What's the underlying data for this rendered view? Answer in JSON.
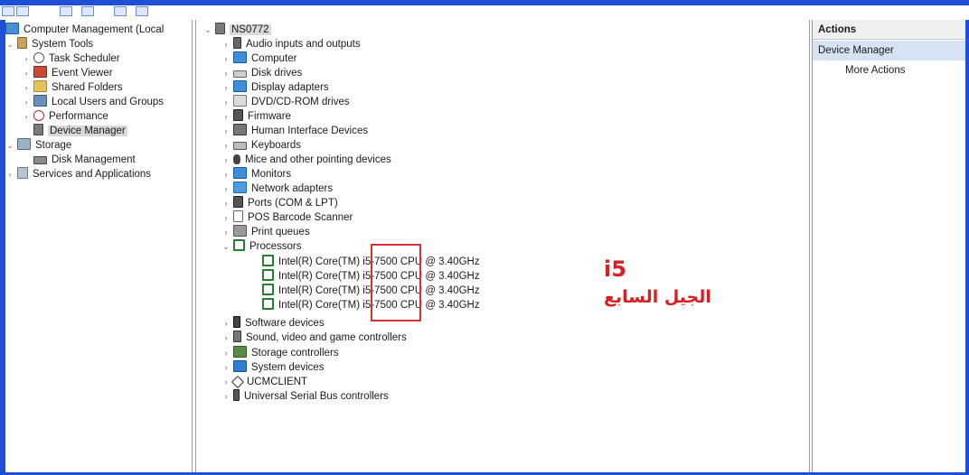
{
  "colors": {
    "frame_blue": "#1f4fd6",
    "annotation_red": "#d92020",
    "selection_gray": "#d9d9d9",
    "actions_selected": "#d6e3f3"
  },
  "left_tree": {
    "root": "Computer Management (Local",
    "system_tools": "System Tools",
    "task_scheduler": "Task Scheduler",
    "event_viewer": "Event Viewer",
    "shared_folders": "Shared Folders",
    "local_users": "Local Users and Groups",
    "performance": "Performance",
    "device_manager": "Device Manager",
    "storage": "Storage",
    "disk_management": "Disk Management",
    "services": "Services and Applications"
  },
  "device_tree": {
    "root": "NS0772",
    "categories": [
      "Audio inputs and outputs",
      "Computer",
      "Disk drives",
      "Display adapters",
      "DVD/CD-ROM drives",
      "Firmware",
      "Human Interface Devices",
      "Keyboards",
      "Mice and other pointing devices",
      "Monitors",
      "Network adapters",
      "Ports (COM & LPT)",
      "POS Barcode Scanner",
      "Print queues",
      "Processors"
    ],
    "processors": [
      "Intel(R) Core(TM) i5-7500 CPU @ 3.40GHz",
      "Intel(R) Core(TM) i5-7500 CPU @ 3.40GHz",
      "Intel(R) Core(TM) i5-7500 CPU @ 3.40GHz",
      "Intel(R) Core(TM) i5-7500 CPU @ 3.40GHz"
    ],
    "after": [
      "Software devices",
      "Sound, video and game controllers",
      "Storage controllers",
      "System devices",
      "UCMCLIENT",
      "Universal Serial Bus controllers"
    ]
  },
  "actions": {
    "title": "Actions",
    "device_manager": "Device Manager",
    "more": "More Actions"
  },
  "annotation": {
    "model": "i5",
    "generation_ar": "الجيل السابع"
  }
}
